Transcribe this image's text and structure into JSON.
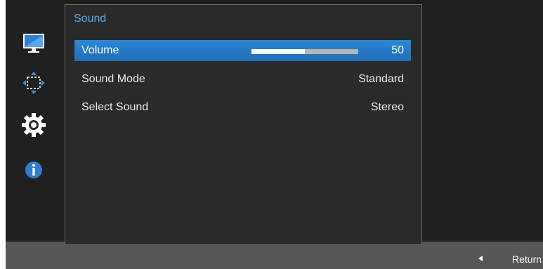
{
  "menu": {
    "title": "Sound",
    "items": [
      {
        "label": "Volume",
        "value": "50",
        "level_fraction": 0.5
      },
      {
        "label": "Sound Mode",
        "value": "Standard"
      },
      {
        "label": "Select Sound",
        "value": "Stereo"
      }
    ]
  },
  "sidebar": {
    "icons": [
      "picture-icon",
      "position-icon",
      "settings-gear-icon",
      "information-icon"
    ]
  },
  "footer": {
    "return_label": "Return",
    "return_icon": "left-arrow-icon"
  },
  "colors": {
    "accent": "#2b87d6",
    "title": "#5fa9e3",
    "panel": "#2a2a2a",
    "bottom_bar": "#565656"
  }
}
